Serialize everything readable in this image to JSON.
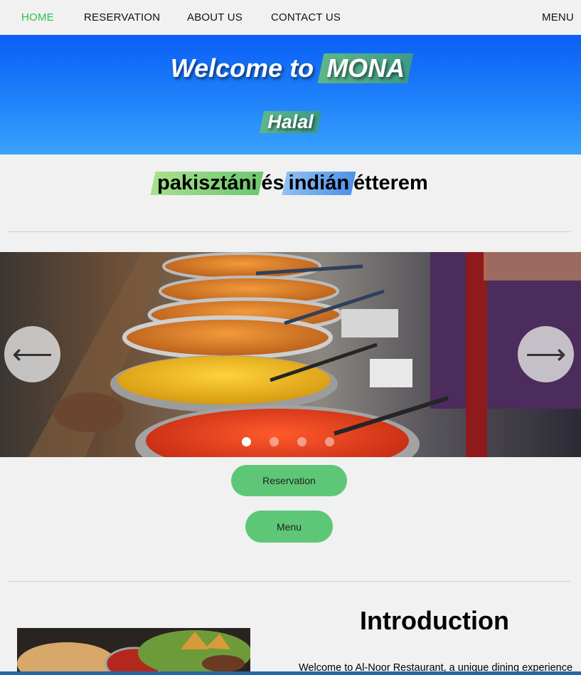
{
  "nav": {
    "items": [
      "HOME",
      "RESERVATION",
      "ABOUT US",
      "CONTACT US"
    ],
    "menu_label": "MENU",
    "active_color": "#2cc24a"
  },
  "hero": {
    "welcome_text": "Welcome to",
    "brand": "MONA",
    "tag": "Halal",
    "gradient_top": "#0a5ff5",
    "gradient_bottom": "#3aa2fc"
  },
  "subtitle": {
    "word1": "pakisztáni",
    "conj": "és",
    "word2": "indián",
    "word3": "étterem"
  },
  "carousel": {
    "prev_icon": "arrow-left-icon",
    "next_icon": "arrow-right-icon",
    "prev_glyph": "⟵",
    "next_glyph": "⟶",
    "slide_count": 4,
    "active_slide": 1
  },
  "buttons": {
    "reservation": "Reservation",
    "menu": "Menu",
    "color": "#5ec777"
  },
  "intro": {
    "title": "Introduction",
    "text": "Welcome to Al-Noor Restaurant, a unique dining experience"
  }
}
